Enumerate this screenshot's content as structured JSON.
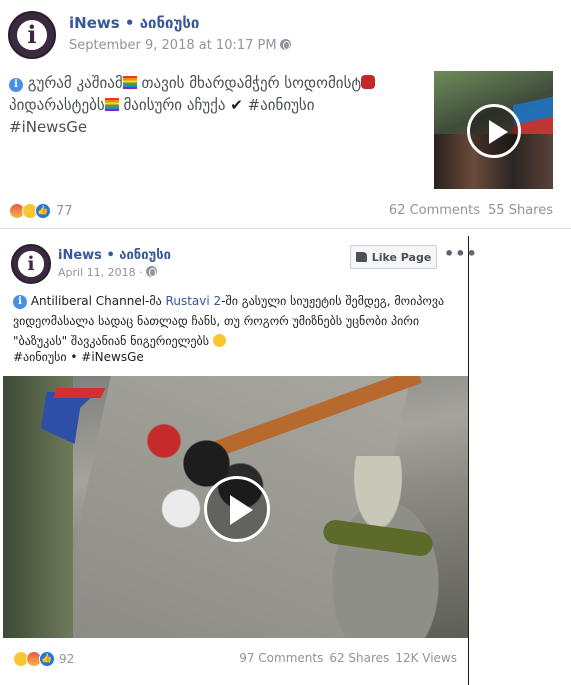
{
  "post1": {
    "page_name": "iNews",
    "page_suffix": "აინიუსი",
    "separator": "•",
    "timestamp": "September 9, 2018 at 10:17 PM",
    "text_a": "გურამ კაშიამ",
    "text_b": " თავის მხარდამჭერ სოდომისტ",
    "text_c": "პიდარასტებს",
    "text_d": " მაისური აჩუქა ",
    "checkmark": "✔",
    "text_e": " #აინიუსი",
    "hashtag2": "#iNewsGe",
    "reaction_count": "77",
    "comments": "62 Comments",
    "shares": "55 Shares"
  },
  "post2": {
    "page_name": "iNews",
    "page_suffix": "აინიუსი",
    "separator": "•",
    "timestamp": "April 11, 2018 ·",
    "like_page_label": "Like Page",
    "more_label": "•••",
    "text_lead": " Antiliberal Channel-მა ",
    "link_text": "Rustavi 2",
    "text_rest": "-ში გასული სიუჟეტის შემდეგ, მოიპოვა ვიდეომასალა სადაც ნათლად ჩანს, თუ როგორ უმიზნებს უცნობი პირი \"ბაზუკას\" შავკანიან ნიგერიელებს",
    "tags": "#აინიუსი • #iNewsGe",
    "reaction_count": "92",
    "comments": "97 Comments",
    "shares": "62 Shares",
    "views": "12K Views"
  },
  "colors": {
    "link_blue": "#385898",
    "meta_gray": "#90949c",
    "like_blue": "#1877f2"
  },
  "icons": {
    "info": "info-icon",
    "globe": "globe-icon",
    "play": "play-icon",
    "thumb": "thumbs-up-icon"
  }
}
